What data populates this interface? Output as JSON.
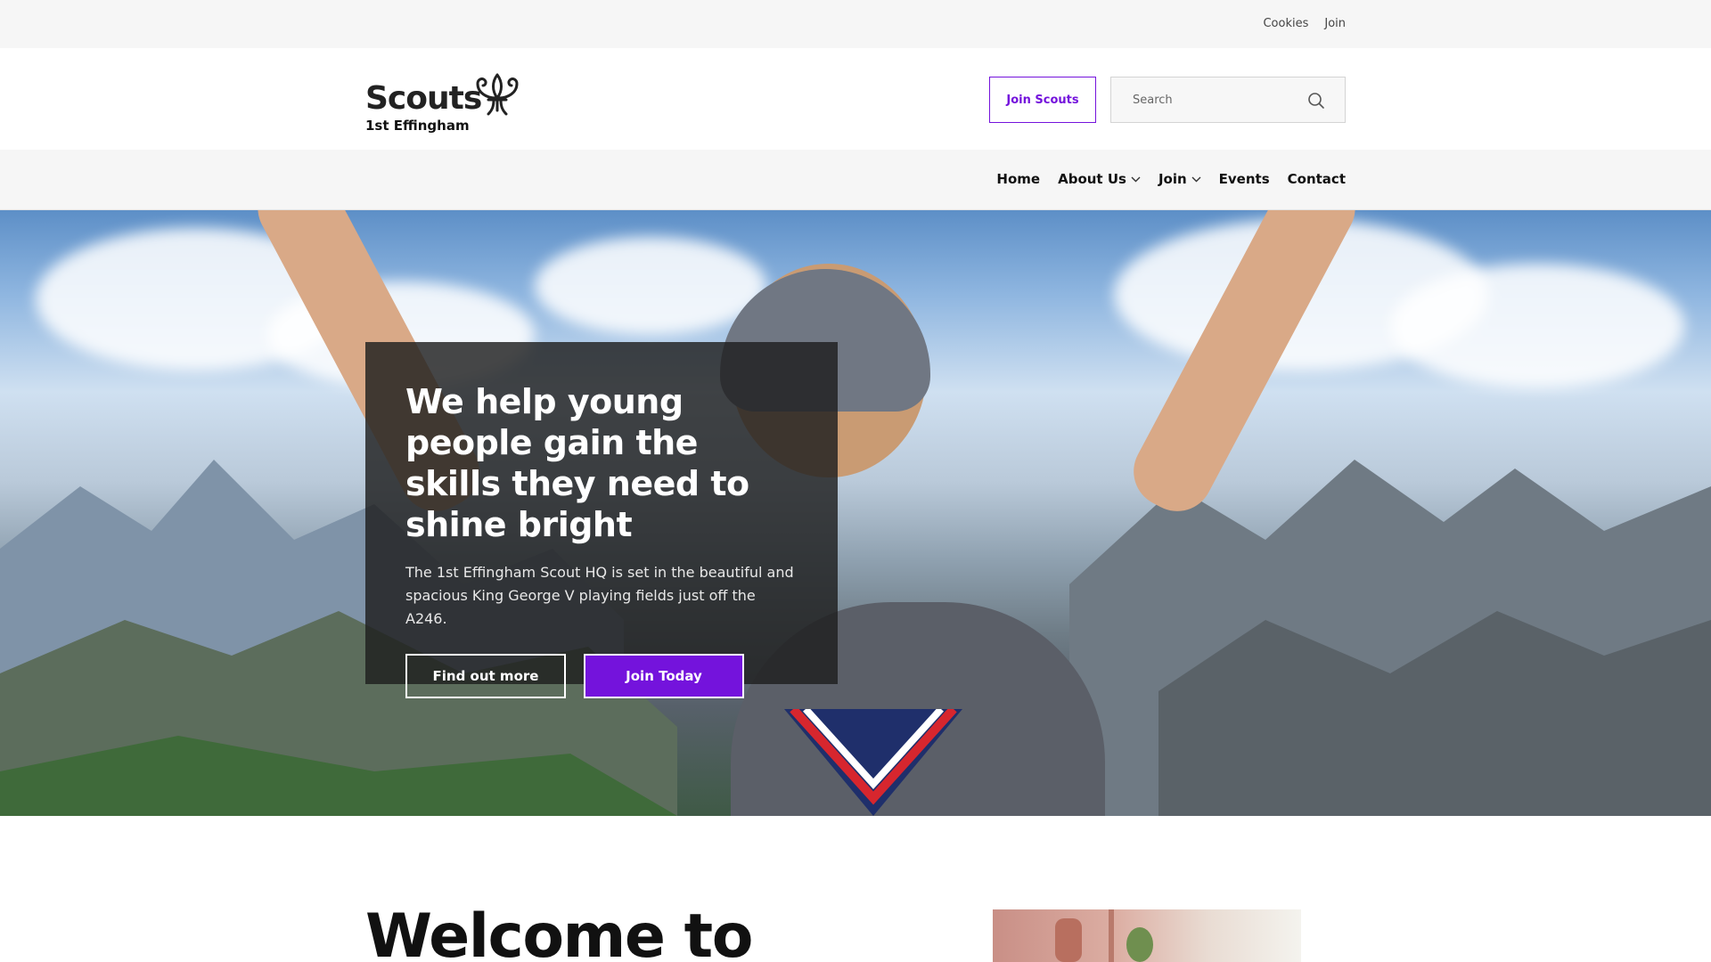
{
  "utility": {
    "cookies": "Cookies",
    "join": "Join"
  },
  "header": {
    "logo_word": "Scouts",
    "logo_subtitle": "1st Effingham",
    "logo_icon": "fleur-de-lis-icon",
    "join_button": "Join Scouts",
    "search": {
      "placeholder": "Search",
      "icon": "search-icon"
    }
  },
  "nav": {
    "items": [
      {
        "label": "Home",
        "has_dropdown": false
      },
      {
        "label": "About Us",
        "has_dropdown": true
      },
      {
        "label": "Join",
        "has_dropdown": true
      },
      {
        "label": "Events",
        "has_dropdown": false
      },
      {
        "label": "Contact",
        "has_dropdown": false
      }
    ]
  },
  "hero": {
    "title": "We help young people gain the skills they need to shine bright",
    "text": "The 1st Effingham Scout HQ is set in the beautiful and spacious King George V playing fields just off the A246.",
    "button_secondary": "Find out more",
    "button_primary": "Join Today"
  },
  "welcome": {
    "heading": "Welcome to"
  },
  "colors": {
    "brand_purple": "#7413dc",
    "utility_bg": "#f6f6f6",
    "card_bg": "#1e1e1e"
  }
}
